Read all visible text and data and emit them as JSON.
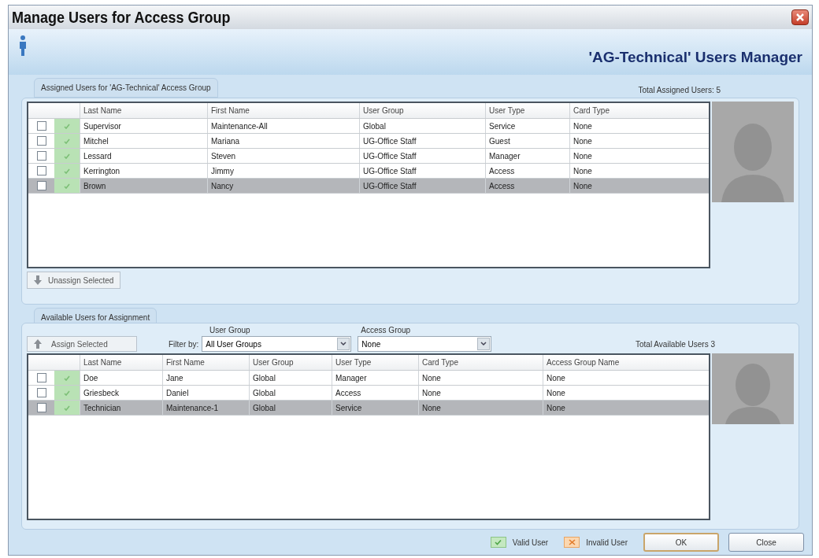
{
  "window": {
    "title": "Manage Users for Access Group"
  },
  "header": {
    "title": "'AG-Technical' Users Manager"
  },
  "assigned": {
    "title": "Assigned Users for 'AG-Technical' Access Group",
    "total": "Total Assigned Users: 5",
    "columns": [
      "Last Name",
      "First Name",
      "User Group",
      "User Type",
      "Card Type"
    ],
    "rows": [
      {
        "checked": false,
        "valid": true,
        "selected": false,
        "cells": [
          "Supervisor",
          "Maintenance-All",
          "Global",
          "Service",
          "None"
        ]
      },
      {
        "checked": false,
        "valid": true,
        "selected": false,
        "cells": [
          "Mitchel",
          "Mariana",
          "UG-Office Staff",
          "Guest",
          "None"
        ]
      },
      {
        "checked": false,
        "valid": true,
        "selected": false,
        "cells": [
          "Lessard",
          "Steven",
          "UG-Office Staff",
          "Manager",
          "None"
        ]
      },
      {
        "checked": false,
        "valid": true,
        "selected": false,
        "cells": [
          "Kerrington",
          "Jimmy",
          "UG-Office Staff",
          "Access",
          "None"
        ]
      },
      {
        "checked": false,
        "valid": true,
        "selected": true,
        "cells": [
          "Brown",
          "Nancy",
          "UG-Office Staff",
          "Access",
          "None"
        ]
      }
    ],
    "button": "Unassign Selected"
  },
  "available": {
    "title": "Available Users for Assignment",
    "button": "Assign Selected",
    "user_group_label": "User Group",
    "filter_label": "Filter by:",
    "user_group_value": "All User Groups",
    "access_group_label": "Access Group",
    "access_group_value": "None",
    "total": "Total Available Users 3",
    "columns": [
      "Last Name",
      "First Name",
      "User Group",
      "User Type",
      "Card Type",
      "Access Group Name"
    ],
    "rows": [
      {
        "checked": false,
        "valid": true,
        "selected": false,
        "cells": [
          "Doe",
          "Jane",
          "Global",
          "Manager",
          "None",
          "None"
        ]
      },
      {
        "checked": false,
        "valid": true,
        "selected": false,
        "cells": [
          "Griesbeck",
          "Daniel",
          "Global",
          "Access",
          "None",
          "None"
        ]
      },
      {
        "checked": false,
        "valid": true,
        "selected": true,
        "cells": [
          "Technician",
          "Maintenance-1",
          "Global",
          "Service",
          "None",
          "None"
        ]
      }
    ]
  },
  "legend": [
    {
      "kind": "valid",
      "label": "Valid User"
    },
    {
      "kind": "invalid",
      "label": "Invalid User"
    }
  ],
  "buttons": [
    {
      "label": "OK",
      "focused": true
    },
    {
      "label": "Close",
      "focused": false
    }
  ]
}
